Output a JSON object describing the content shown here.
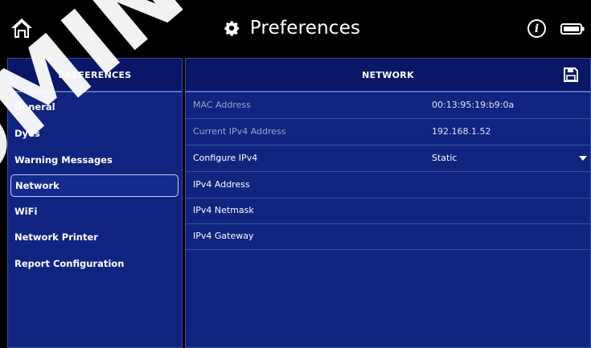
{
  "header": {
    "title": "Preferences",
    "home_icon": "home-icon",
    "gear_icon": "gear-icon",
    "info_icon": "info-icon",
    "info_glyph": "i",
    "battery_icon": "battery-icon"
  },
  "sidebar": {
    "header": "PREFERENCES",
    "items": [
      {
        "label": "General"
      },
      {
        "label": "Dyes"
      },
      {
        "label": "Warning Messages"
      },
      {
        "label": "Network",
        "selected": true
      },
      {
        "label": "WiFi"
      },
      {
        "label": "Network Printer"
      },
      {
        "label": "Report Configuration"
      }
    ]
  },
  "main": {
    "header": "NETWORK",
    "save_icon": "save-icon",
    "rows": [
      {
        "label": "MAC Address",
        "value": "00:13:95:19:b9:0a",
        "editable": false
      },
      {
        "label": "Current IPv4 Address",
        "value": "192.168.1.52",
        "editable": false
      },
      {
        "label": "Configure IPv4",
        "value": "Static",
        "editable": true,
        "dropdown": true
      },
      {
        "label": "IPv4 Address",
        "value": "",
        "editable": true
      },
      {
        "label": "IPv4 Netmask",
        "value": "",
        "editable": true
      },
      {
        "label": "IPv4 Gateway",
        "value": "",
        "editable": true
      }
    ]
  },
  "watermark": "OMINI",
  "colors": {
    "panel": "#10237f",
    "header_bg": "#0a1767",
    "background": "#000000",
    "text": "#ffffff"
  }
}
